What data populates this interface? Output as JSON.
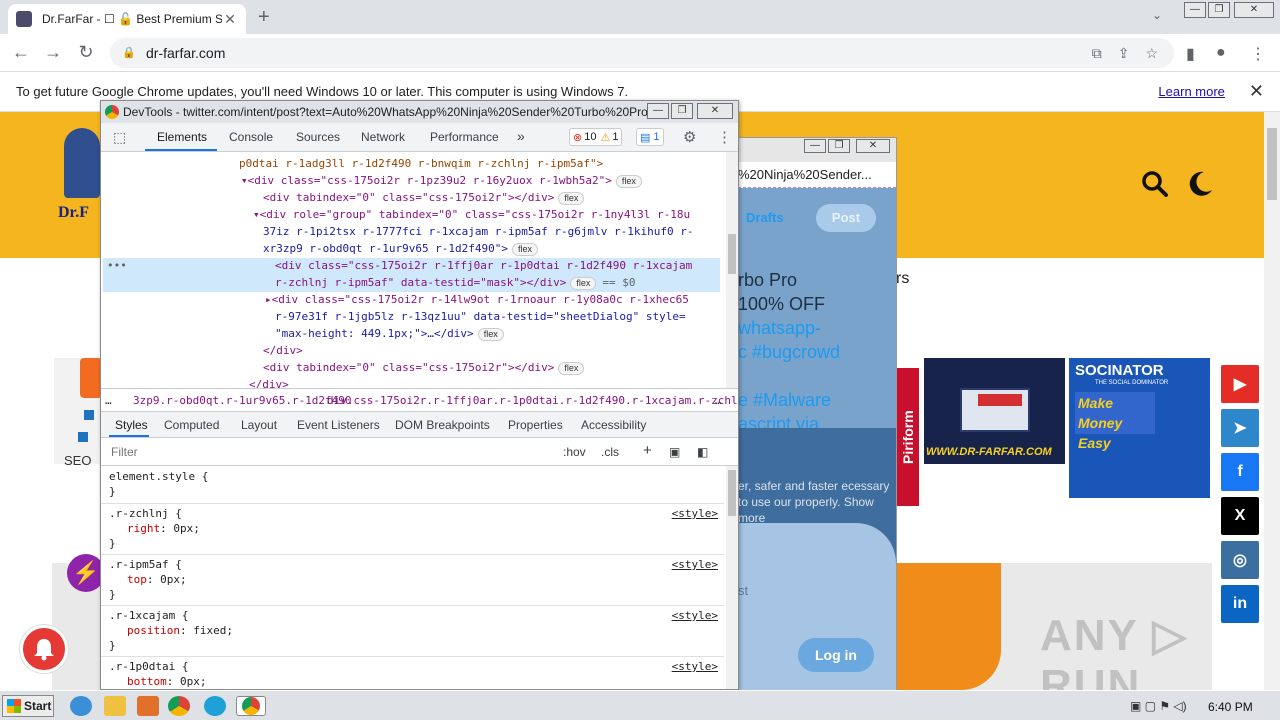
{
  "browser": {
    "tab_title": "Dr.FarFar - ☐ 🔓 Best Premium Soft",
    "address": "dr-farfar.com",
    "info_message": "To get future Google Chrome updates, you'll need Windows 10 or later. This computer is using Windows 7.",
    "learn_more": "Learn more"
  },
  "page": {
    "logo_text": "Dr.F",
    "nav_fragment": "rs",
    "seo_fragment": "SEO",
    "piriform": "Piriform",
    "ad1_caption": "WWW.DR-FARFAR.COM",
    "ad2_brand": "SOCINATOR",
    "ad2_sub": "THE SOCIAL DOMINATOR",
    "ad2_big": "Make Money Easy"
  },
  "social": [
    {
      "name": "youtube",
      "glyph": "▶",
      "color": "#e52d27"
    },
    {
      "name": "telegram",
      "glyph": "➤",
      "color": "#2e87ca"
    },
    {
      "name": "facebook",
      "glyph": "f",
      "color": "#1877f2"
    },
    {
      "name": "x",
      "glyph": "X",
      "color": "#000000"
    },
    {
      "name": "instagram",
      "glyph": "◎",
      "color": "#3b6fa0"
    },
    {
      "name": "linkedin",
      "glyph": "in",
      "color": "#0a66c2"
    }
  ],
  "twitter_window": {
    "url": "%20Ninja%20Sender...",
    "drafts": "Drafts",
    "post": "Post",
    "tweet_text": "rbo Pro",
    "tweet_line2": "100% OFF",
    "tweet_tag1": "whatsapp-",
    "tweet_tag2": "c #bugcrowd",
    "tweet_tag3": "e #Malware",
    "tweet_via": "ascript via",
    "cookie_text": "er, safer and faster ecessary to use our properly. Show more",
    "st_fragment": "st",
    "login": "Log in"
  },
  "devtools": {
    "title": "DevTools - twitter.com/intent/post?text=Auto%20WhatsApp%20Ninja%20Sender%20Turbo%20Pro%2...",
    "tabs": [
      "Elements",
      "Console",
      "Sources",
      "Network",
      "Performance"
    ],
    "more": "»",
    "errors": "10",
    "warnings": "1",
    "messages": "1",
    "dom": [
      "p0dtai r-1adg3ll r-1d2f490 r-bnwqim r-zchlnj r-ipm5af\">",
      "▾<div class=\"css-175oi2r r-1pz39u2 r-16y2uox r-1wbh5a2\">",
      "<div tabindex=\"0\" class=\"css-175oi2r\"></div>",
      "▾<div role=\"group\" tabindex=\"0\" class=\"css-175oi2r r-1ny4l3l r-18u",
      "37iz r-1pi2tsx r-1777fci r-1xcajam r-ipm5af r-g6jmlv r-1kihuf0 r-",
      "xr3zp9 r-obd0qt r-1ur9v65 r-1d2f490\">",
      "<div class=\"css-175oi2r r-1ffj0ar r-1p0dtai r-1d2f490 r-1xcajam",
      "r-zchlnj r-ipm5af\" data-testid=\"mask\"></div>",
      "▸<div class=\"css-175oi2r r-14lw9ot r-1rnoaur r-1y08a0c r-1xhec65",
      "r-97e31f r-1jgb5lz r-13qz1uu\" data-testid=\"sheetDialog\" style=",
      "\"max-height: 449.1px;\">…</div>",
      "</div>",
      "<div tabindex=\"0\" class=\"css-175oi2r\"></div>",
      "</div>"
    ],
    "flex_label": "flex",
    "eq_label": "== $0",
    "ellipsis": "•••",
    "crumb1": "3zp9.r-obd0qt.r-1ur9v65.r-1d2f490",
    "crumb2": "div.css-175oi2r.r-1ffj0ar.r-1p0dtai.r-1d2f490.r-1xcajam.r-zchlnj.r-ipm5af",
    "crumb_more": "…",
    "style_tabs": [
      "Styles",
      "Computed",
      "Layout",
      "Event Listeners",
      "DOM Breakpoints",
      "Properties",
      "Accessibility"
    ],
    "filter_placeholder": "Filter",
    "hov": ":hov",
    "cls": ".cls",
    "plus": "+",
    "rules": [
      {
        "selector": "element.style {",
        "prop": "",
        "value": "",
        "source": ""
      },
      {
        "selector": ".r-zchlnj {",
        "prop": "right",
        "value": "0px;",
        "source": "<style>"
      },
      {
        "selector": ".r-ipm5af {",
        "prop": "top",
        "value": "0px;",
        "source": "<style>"
      },
      {
        "selector": ".r-1xcajam {",
        "prop": "position",
        "value": "fixed;",
        "source": "<style>"
      },
      {
        "selector": ".r-1p0dtai {",
        "prop": "bottom",
        "value": "0px;",
        "source": "<style>"
      }
    ]
  },
  "taskbar": {
    "start": "Start",
    "time": "6:40 PM"
  },
  "watermark": "ANY ▷ RUN"
}
